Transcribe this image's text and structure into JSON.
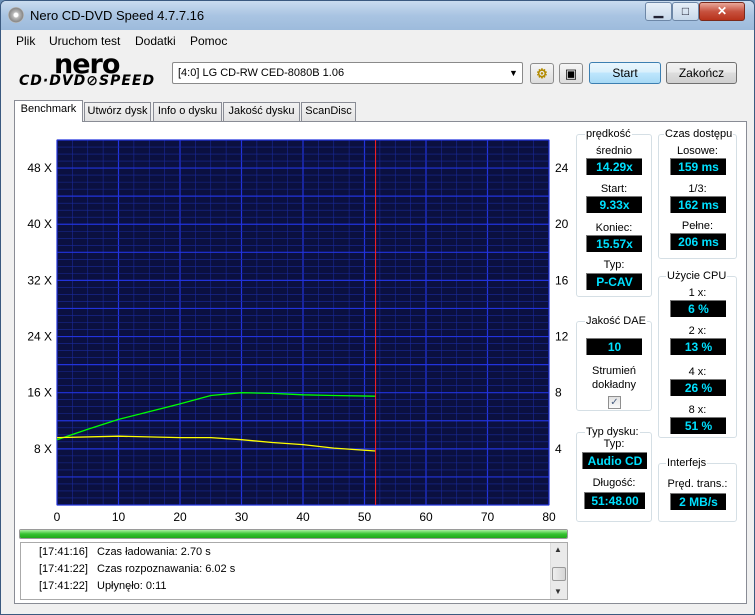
{
  "window": {
    "title": "Nero CD-DVD Speed 4.7.7.16",
    "min_glyph": "▁",
    "max_glyph": "□",
    "close_glyph": "✕"
  },
  "menu": [
    "Plik",
    "Uruchom test",
    "Dodatki",
    "Pomoc"
  ],
  "logo": {
    "line1": "nero",
    "line2": "CD·DVD⊘SPEED"
  },
  "toolbar": {
    "drive": "[4:0]  LG CD-RW CED-8080B 1.06",
    "start": "Start",
    "stop": "Zakończ",
    "eject_icon": "eject-icon",
    "save_icon": "save-icon"
  },
  "tabs": [
    "Benchmark",
    "Utwórz dysk",
    "Info o dysku",
    "Jakość dysku",
    "ScanDisc"
  ],
  "speed": {
    "title": "prędkość",
    "avg_label": "średnio",
    "avg": "14.29x",
    "start_label": "Start:",
    "start": "9.33x",
    "end_label": "Koniec:",
    "end": "15.57x",
    "type_label": "Typ:",
    "type": "P-CAV"
  },
  "access": {
    "title": "Czas dostępu",
    "random_label": "Losowe:",
    "random": "159 ms",
    "third_label": "1/3:",
    "third": "162 ms",
    "full_label": "Pełne:",
    "full": "206 ms"
  },
  "cpu": {
    "title": "Użycie CPU",
    "rows": [
      {
        "label": "1 x:",
        "value": "6 %"
      },
      {
        "label": "2 x:",
        "value": "13 %"
      },
      {
        "label": "4 x:",
        "value": "26 %"
      },
      {
        "label": "8 x:",
        "value": "51 %"
      }
    ]
  },
  "dae": {
    "title": "Jakość DAE",
    "value": "10",
    "stream_label": "Strumień dokładny",
    "stream_checked": true
  },
  "disc": {
    "title": "Typ dysku:",
    "type_label": "Typ:",
    "type": "Audio CD",
    "length_label": "Długość:",
    "length": "51:48.00"
  },
  "iface": {
    "title": "Interfejs",
    "burst_label": "Pręd. trans.:",
    "burst": "2 MB/s"
  },
  "log": [
    {
      "time": "[17:41:16]",
      "text": "Czas ładowania: 2.70 s"
    },
    {
      "time": "[17:41:22]",
      "text": "Czas rozpoznawania: 6.02 s"
    },
    {
      "time": "[17:41:22]",
      "text": "Upłynęło:  0:11"
    }
  ],
  "progress": 1.0,
  "chart_data": {
    "type": "line",
    "x_ticks": [
      0,
      10,
      20,
      30,
      40,
      50,
      60,
      70,
      80
    ],
    "y_left_ticks": [
      "8 X",
      "16 X",
      "24 X",
      "32 X",
      "40 X",
      "48 X"
    ],
    "y_right_ticks": [
      4,
      8,
      12,
      16,
      20,
      24
    ],
    "xlim": [
      0,
      80
    ],
    "ylim_left": [
      0,
      52
    ],
    "ylim_right": [
      0,
      26
    ],
    "grid": true,
    "marker_x": 51.8,
    "series": [
      {
        "color": "#00ff00",
        "points": [
          [
            0,
            9.3
          ],
          [
            5,
            10.8
          ],
          [
            10,
            12.2
          ],
          [
            15,
            13.3
          ],
          [
            20,
            14.4
          ],
          [
            25,
            15.6
          ],
          [
            30,
            16.0
          ],
          [
            35,
            15.9
          ],
          [
            40,
            15.7
          ],
          [
            45,
            15.6
          ],
          [
            51.8,
            15.5
          ]
        ]
      },
      {
        "color": "#ffff00",
        "points": [
          [
            0,
            9.6
          ],
          [
            10,
            9.8
          ],
          [
            20,
            9.6
          ],
          [
            25,
            9.6
          ],
          [
            30,
            9.3
          ],
          [
            35,
            8.9
          ],
          [
            40,
            8.6
          ],
          [
            45,
            8.1
          ],
          [
            51.8,
            7.7
          ]
        ]
      }
    ]
  }
}
